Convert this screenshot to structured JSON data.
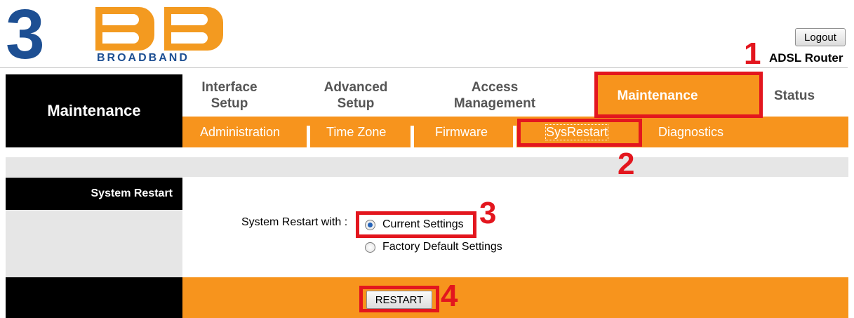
{
  "logo": {
    "mark": "3",
    "subtitle": "BROADBAND"
  },
  "header": {
    "logout_label": "Logout",
    "device_label": "ADSL Router"
  },
  "nav": {
    "section_title": "Maintenance",
    "menu": [
      {
        "label": "Interface Setup"
      },
      {
        "label": "Advanced Setup"
      },
      {
        "label": "Access Management"
      },
      {
        "label": "Maintenance",
        "active": true
      },
      {
        "label": "Status"
      }
    ],
    "submenu": [
      {
        "label": "Administration"
      },
      {
        "label": "Time Zone"
      },
      {
        "label": "Firmware"
      },
      {
        "label": "SysRestart",
        "active": true
      },
      {
        "label": "Diagnostics"
      }
    ]
  },
  "content": {
    "section_label": "System Restart",
    "restart_with_label": "System Restart with :",
    "options": [
      {
        "label": "Current Settings",
        "checked": true
      },
      {
        "label": "Factory Default Settings",
        "checked": false
      }
    ],
    "restart_button": "RESTART"
  },
  "annotations": {
    "steps": [
      "1",
      "2",
      "3",
      "4"
    ],
    "color": "#e3161e"
  },
  "colors": {
    "accent": "#f7941d",
    "logo_blue": "#1d4f93",
    "black": "#000000",
    "panel_gray": "#e6e6e6"
  }
}
